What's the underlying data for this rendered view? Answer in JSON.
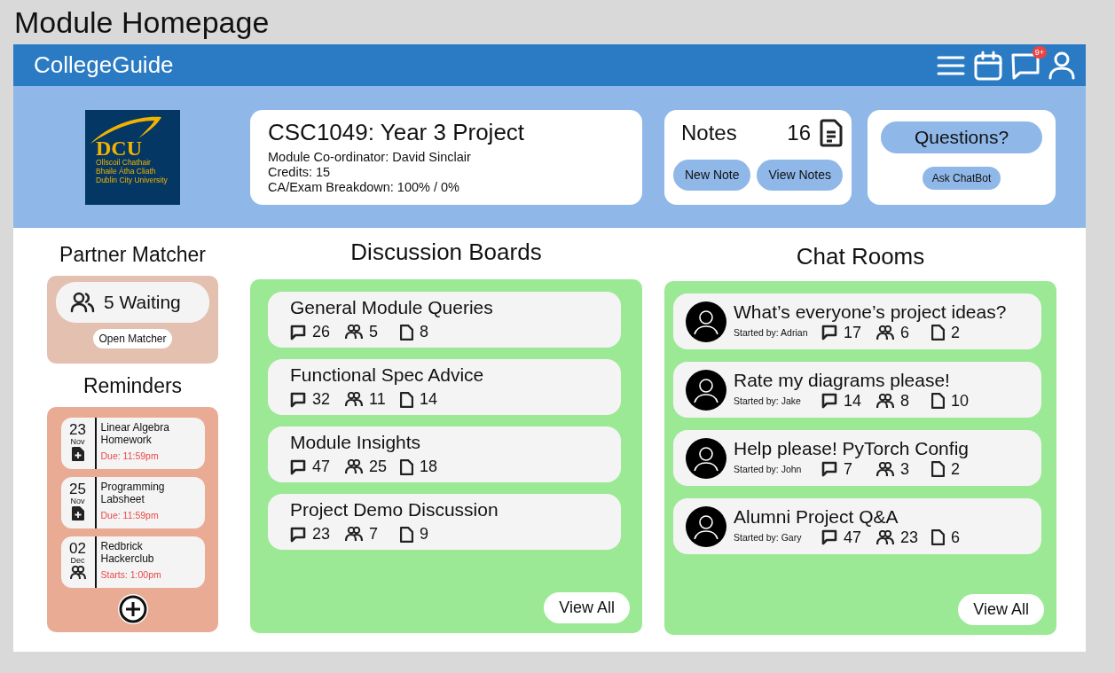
{
  "page_title": "Module Homepage",
  "nav": {
    "brand": "CollegeGuide",
    "badge": "9+"
  },
  "logo": {
    "letters": "DCU",
    "lines": [
      "Ollscoil Chathair",
      "Bhaile Átha Cliath",
      "Dublin City University"
    ]
  },
  "module": {
    "title": "CSC1049: Year 3 Project",
    "details": [
      "Module Co-ordinator: David Sinclair",
      "Credits: 15",
      "CA/Exam Breakdown: 100% / 0%"
    ]
  },
  "notes": {
    "label": "Notes",
    "count": "16",
    "buttons": [
      "New Note",
      "View Notes"
    ]
  },
  "questions": {
    "label": "Questions?",
    "button": "Ask ChatBot"
  },
  "partner_matcher": {
    "title": "Partner Matcher",
    "waiting": "5 Waiting",
    "button": "Open Matcher"
  },
  "reminders": {
    "title": "Reminders",
    "items": [
      {
        "day": "23",
        "month": "Nov",
        "kind": "assignment",
        "title": "Linear Algebra Homework",
        "time": "Due: 11:59pm"
      },
      {
        "day": "25",
        "month": "Nov",
        "kind": "assignment",
        "title": "Programming Labsheet",
        "time": "Due: 11:59pm"
      },
      {
        "day": "02",
        "month": "Dec",
        "kind": "event",
        "title": "Redbrick Hackerclub",
        "time": "Starts: 1:00pm"
      }
    ]
  },
  "discussion_boards": {
    "title": "Discussion Boards",
    "button": "View All",
    "items": [
      {
        "title": "General Module Queries",
        "messages": "26",
        "members": "5",
        "files": "8"
      },
      {
        "title": "Functional Spec Advice",
        "messages": "32",
        "members": "11",
        "files": "14"
      },
      {
        "title": "Module Insights",
        "messages": "47",
        "members": "25",
        "files": "18"
      },
      {
        "title": "Project Demo Discussion",
        "messages": "23",
        "members": "7",
        "files": "9"
      }
    ]
  },
  "chat_rooms": {
    "title": "Chat Rooms",
    "button": "View All",
    "items": [
      {
        "title": "What’s everyone’s project ideas?",
        "starter": "Started by: Adrian",
        "messages": "17",
        "members": "6",
        "files": "2"
      },
      {
        "title": "Rate my diagrams please!",
        "starter": "Started by: Jake",
        "messages": "14",
        "members": "8",
        "files": "10"
      },
      {
        "title": "Help please! PyTorch Config",
        "starter": "Started by: John",
        "messages": "7",
        "members": "3",
        "files": "2"
      },
      {
        "title": "Alumni Project Q&A",
        "starter": "Started by: Gary",
        "messages": "47",
        "members": "23",
        "files": "6"
      }
    ]
  }
}
